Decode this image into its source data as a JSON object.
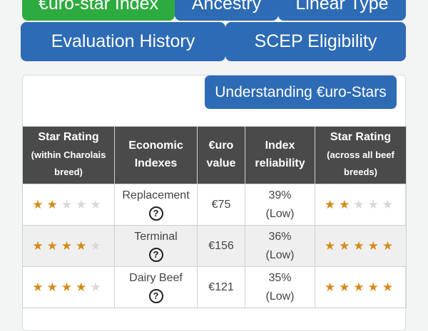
{
  "tabs_row1": [
    {
      "label": "€uro-star Index",
      "active": true
    },
    {
      "label": "Ancestry",
      "active": false
    },
    {
      "label": "Linear Type",
      "active": false
    }
  ],
  "tabs_row2": [
    {
      "label": "Evaluation History"
    },
    {
      "label": "SCEP Eligibility"
    }
  ],
  "understanding_button": "Understanding €uro-Stars",
  "table": {
    "headers": {
      "within_main": "Star Rating",
      "within_sub": "(within Charolais breed)",
      "indexes_main": "Economic",
      "indexes_sub": "Indexes",
      "euro_main": "€uro",
      "euro_sub": "value",
      "reliability_main": "Index",
      "reliability_sub": "reliability",
      "across_main": "Star Rating",
      "across_sub": "(across all beef breeds)"
    },
    "rows": [
      {
        "index": "Replacement",
        "euro_value": "€75",
        "reliability_pct": "39%",
        "reliability_level": "(Low)",
        "within_stars": 2,
        "across_stars": 2
      },
      {
        "index": "Terminal",
        "euro_value": "€156",
        "reliability_pct": "36%",
        "reliability_level": "(Low)",
        "within_stars": 4,
        "across_stars": 5
      },
      {
        "index": "Dairy Beef",
        "euro_value": "€121",
        "reliability_pct": "35%",
        "reliability_level": "(Low)",
        "within_stars": 4,
        "across_stars": 5
      }
    ],
    "help_glyph": "?",
    "star_glyph": "★"
  },
  "colors": {
    "active_tab": "#2eab3f",
    "tab": "#2d6bb5",
    "header_bg": "#4a4a4a",
    "star_on": "#d68a1a",
    "star_off": "#d8d8d8"
  }
}
